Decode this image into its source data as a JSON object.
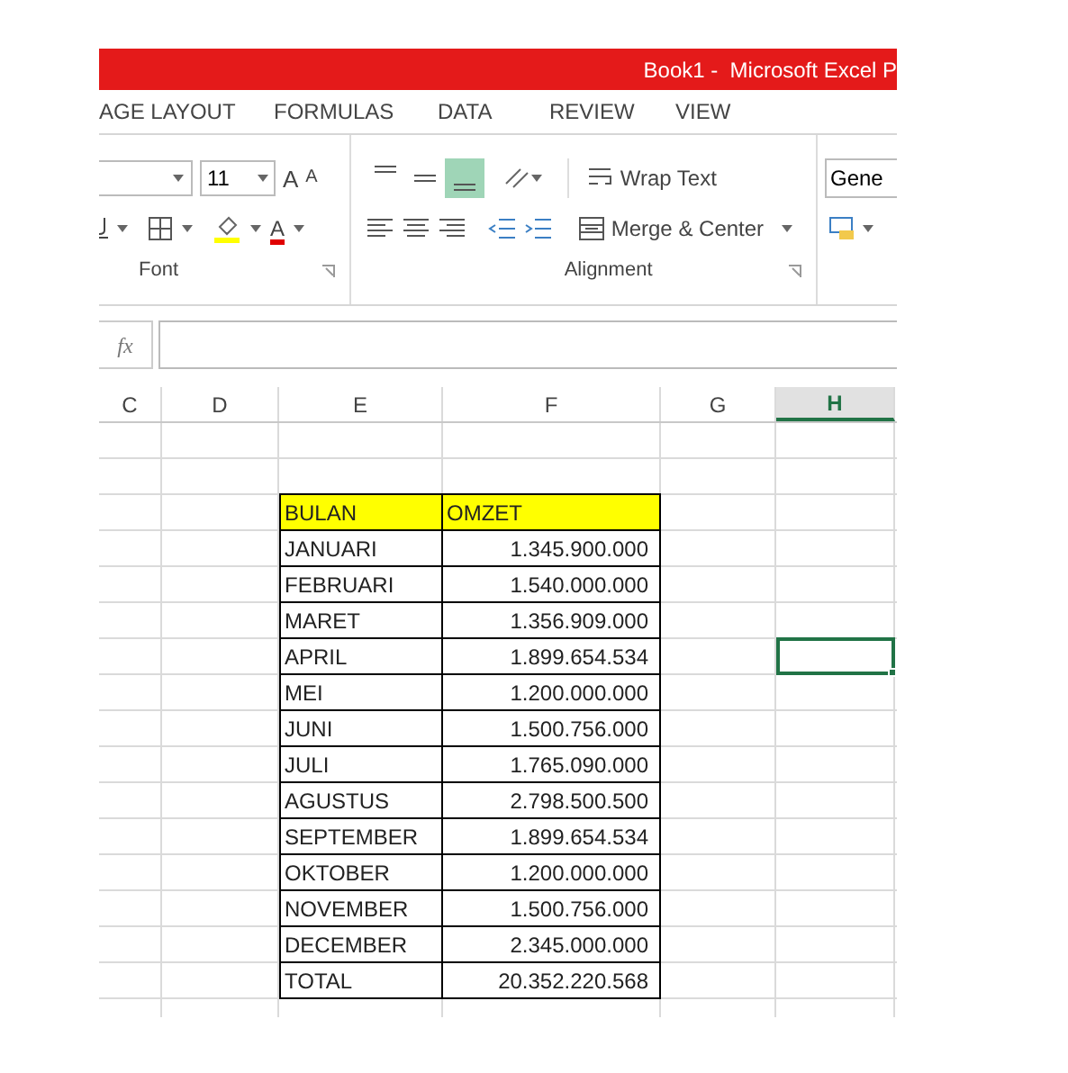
{
  "title": "Book1 -  Microsoft Excel P",
  "tabs": [
    "AGE LAYOUT",
    "FORMULAS",
    "DATA",
    "REVIEW",
    "VIEW"
  ],
  "ribbon": {
    "font_size": "11",
    "grow_font": "A",
    "shrink_font": "A",
    "font_color": "A",
    "vertical_align": [
      {
        "kind": "top",
        "selected": false
      },
      {
        "kind": "middle",
        "selected": false
      },
      {
        "kind": "bottom",
        "selected": true
      }
    ],
    "wrap_text": "Wrap Text",
    "merge_center": "Merge & Center",
    "number_format": "Gene",
    "groups": [
      "Font",
      "Alignment"
    ]
  },
  "formula_bar": {
    "fx": "fx"
  },
  "columns": [
    {
      "label": "C",
      "selected": false
    },
    {
      "label": "D",
      "selected": false
    },
    {
      "label": "E",
      "selected": false
    },
    {
      "label": "F",
      "selected": false
    },
    {
      "label": "G",
      "selected": false
    },
    {
      "label": "H",
      "selected": true
    }
  ],
  "rows": [
    {
      "kind": "blank",
      "selected": false
    },
    {
      "kind": "blank",
      "selected": false
    },
    {
      "kind": "header",
      "bulan": "BULAN",
      "omzet": "OMZET",
      "selected": false
    },
    {
      "kind": "data",
      "bulan": "JANUARI",
      "omzet": "1.345.900.000",
      "selected": false
    },
    {
      "kind": "data",
      "bulan": "FEBRUARI",
      "omzet": "1.540.000.000",
      "selected": false
    },
    {
      "kind": "data",
      "bulan": "MARET",
      "omzet": "1.356.909.000",
      "selected": false
    },
    {
      "kind": "data",
      "bulan": "APRIL",
      "omzet": "1.899.654.534",
      "selected": true
    },
    {
      "kind": "data",
      "bulan": "MEI",
      "omzet": "1.200.000.000",
      "selected": false
    },
    {
      "kind": "data",
      "bulan": "JUNI",
      "omzet": "1.500.756.000",
      "selected": false
    },
    {
      "kind": "data",
      "bulan": "JULI",
      "omzet": "1.765.090.000",
      "selected": false
    },
    {
      "kind": "data",
      "bulan": "AGUSTUS",
      "omzet": "2.798.500.500",
      "selected": false
    },
    {
      "kind": "data",
      "bulan": "SEPTEMBER",
      "omzet": "1.899.654.534",
      "selected": false
    },
    {
      "kind": "data",
      "bulan": "OKTOBER",
      "omzet": "1.200.000.000",
      "selected": false
    },
    {
      "kind": "data",
      "bulan": "NOVEMBER",
      "omzet": "1.500.756.000",
      "selected": false
    },
    {
      "kind": "data",
      "bulan": "DECEMBER",
      "omzet": "2.345.000.000",
      "selected": false
    },
    {
      "kind": "total",
      "bulan": "TOTAL",
      "omzet": "20.352.220.568",
      "selected": false
    }
  ]
}
